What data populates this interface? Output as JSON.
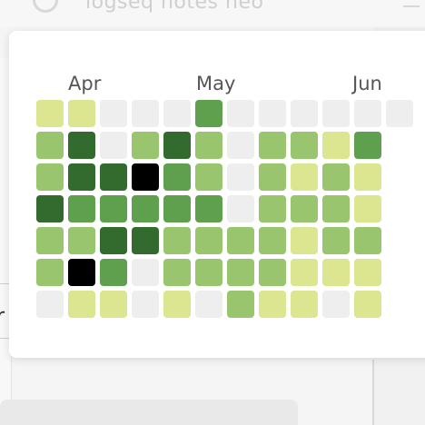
{
  "app": {
    "title": "logseq notes neo"
  },
  "background": {
    "left_partial_text": "r"
  },
  "heatmap": {
    "months": [
      "Apr",
      "May",
      "Jun"
    ],
    "levels": {
      "0": "#eeeeee",
      "1": "#dce590",
      "2": "#98c56e",
      "3": "#5fa04e",
      "4": "#336b2e",
      "5": "#000000"
    },
    "rows": [
      [
        1,
        1,
        0,
        0,
        0,
        3,
        0,
        0,
        0,
        0,
        0,
        0
      ],
      [
        2,
        4,
        0,
        2,
        4,
        2,
        0,
        2,
        2,
        1,
        3
      ],
      [
        2,
        4,
        4,
        5,
        3,
        2,
        0,
        2,
        1,
        2,
        1
      ],
      [
        4,
        3,
        3,
        3,
        3,
        3,
        0,
        2,
        2,
        2,
        1
      ],
      [
        2,
        2,
        4,
        4,
        2,
        2,
        2,
        2,
        1,
        2,
        2
      ],
      [
        2,
        5,
        3,
        0,
        2,
        2,
        2,
        2,
        1,
        1,
        1
      ],
      [
        0,
        1,
        1,
        0,
        1,
        0,
        2,
        1,
        1,
        0,
        1
      ]
    ]
  }
}
